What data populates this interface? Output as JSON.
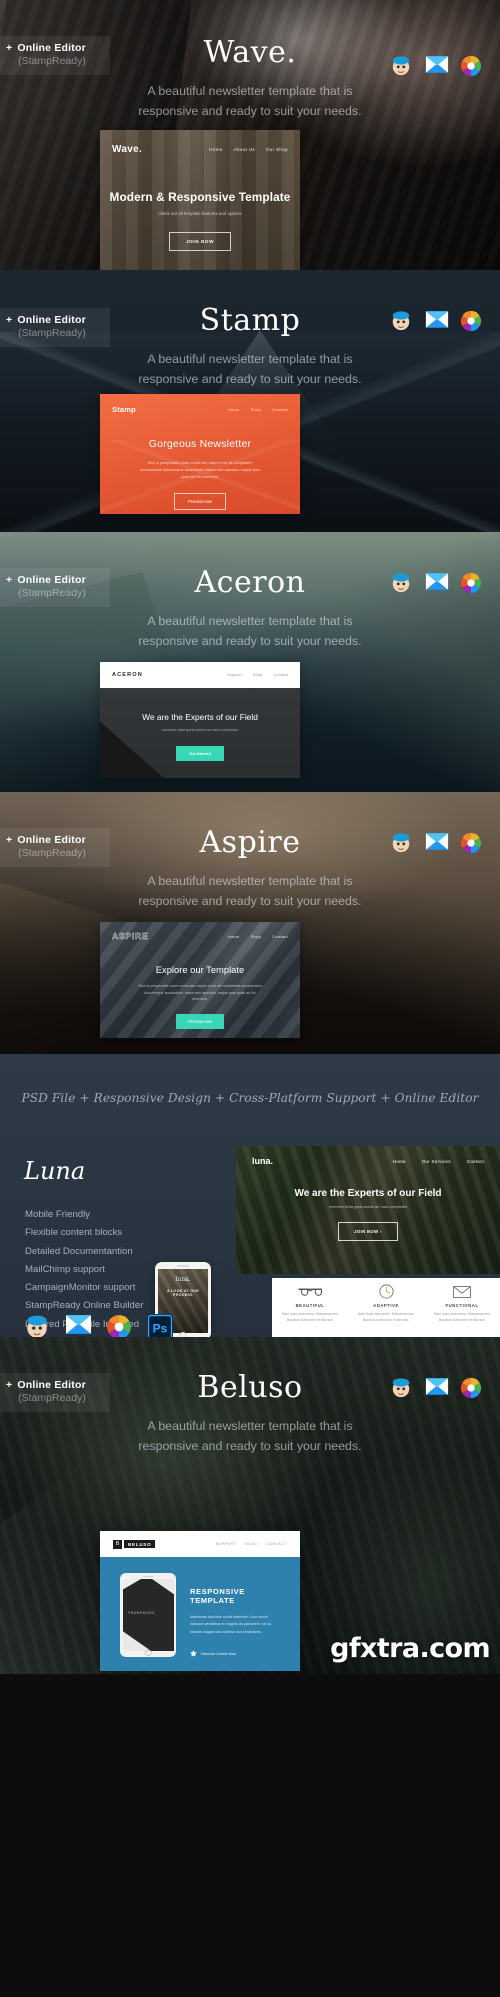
{
  "badge": {
    "plus": "+",
    "line1": "Online Editor",
    "line2": "(StampReady)"
  },
  "icons": [
    {
      "name": "mailchimp-icon",
      "label": "MailChimp"
    },
    {
      "name": "campaignmonitor-icon",
      "label": "Campaign Monitor"
    },
    {
      "name": "stampready-icon",
      "label": "StampReady"
    },
    {
      "name": "photoshop-icon",
      "label": "Ps"
    }
  ],
  "shared": {
    "subtitle_line1": "A beautiful newsletter template that is",
    "subtitle_line2": "responsive and ready to suit your needs."
  },
  "panels": [
    {
      "id": "wave",
      "title": "Wave.",
      "card": {
        "logo": "Wave.",
        "nav": [
          "Home",
          "About Us",
          "Our Shop"
        ],
        "heading": "Modern & Responsive Template",
        "sub": "check out all template features and options",
        "button": "JOIN NOW"
      }
    },
    {
      "id": "stamp",
      "title": "Stamp",
      "card": {
        "logo": "Stamp",
        "nav": [
          "Home",
          "Shop",
          "Contact"
        ],
        "heading": "Gorgeous Newsletter",
        "body1": "Sed ut perspiciatis unde omnis iste natus error sit voluptatem",
        "body2": "accusantium doloremque laudantium, totam rem aperiam, eaque ipsa",
        "body3": "quae ab illo inventore.",
        "button": "Preview now"
      }
    },
    {
      "id": "aceron",
      "title": "Aceron",
      "card": {
        "logo": "ACERON",
        "nav": [
          "Support",
          "Shop",
          "Contact"
        ],
        "heading": "We are the Experts of our Field",
        "sub": "overview what great works we have completed",
        "button": "Get Started"
      }
    },
    {
      "id": "aspire",
      "title": "Aspire",
      "card": {
        "logo": "ASPIRE",
        "nav": [
          "Home",
          "Shop",
          "Contact"
        ],
        "heading": "Explore our Template",
        "body1": "Sed ut perspiciatis unde omnis iste neque porro sit voluptatem accusantium",
        "body2": "doloremque laudantium, totam rem aperiam, eaque ipsa quae ab illo",
        "body3": "inventore.",
        "button": "Preview now"
      }
    },
    {
      "id": "beluso",
      "title": "Beluso",
      "card": {
        "logo_mark": "B",
        "logo": "BELUSO",
        "nav": [
          "SUPPORT",
          "BLOG",
          "CONTACT"
        ],
        "heading": "RESPONSIVE TEMPLATE",
        "body1": "Maecenas faucibus mollis interdum. Cum sociis",
        "body2": "natoque penatibus et magnis dis parturient, est at",
        "body3": "lobortis magna sito sublime dus ernandoeis.",
        "cta": "Discover Create Now",
        "phone_label": "FRAMEWORK"
      }
    }
  ],
  "features": {
    "tagline": "PSD File + Responsive Design + Cross-Platform Support + Online Editor",
    "brand": "Luna",
    "list": [
      "Mobile Friendly",
      "Flexible content blocks",
      "Detailed Documentantion",
      "MailChimp support",
      "CampaignMonitor support",
      "StampReady Online Builder",
      "Layered PSD File Included"
    ],
    "preview": {
      "logo": "luna.",
      "nav": [
        "Home",
        "Our Services",
        "Contact"
      ],
      "heading": "We are the Experts of our Field",
      "sub": "overview what great works we have completed",
      "button": "JOIN NOW  ›"
    },
    "phone": {
      "logo": "luna.",
      "caption": "A LOOK AT OUR PROCESS"
    },
    "cells": [
      {
        "icon": "glasses-icon",
        "title": "BEAUTIFUL",
        "text": "Nam dolor duis lorem. Maecenas ens faucibus nulla dolor et faci dos."
      },
      {
        "icon": "clock-icon",
        "title": "ADAPTIVE",
        "text": "Nam dolor duis lorem. Maecenas ens faucibus nulla dolor et faci dos."
      },
      {
        "icon": "envelope-icon",
        "title": "FUNCTIONAL",
        "text": "Nam dolor duis lorem. Maecenas ens faucibus nulla dolor et faci dos."
      }
    ]
  },
  "watermark": "gfxtra.com",
  "colors": {
    "stamp_orange": "#e2552f",
    "aceron_teal": "#37d6b5",
    "beluso_blue": "#2e81ad",
    "panel_navy": "#2e3a47"
  }
}
